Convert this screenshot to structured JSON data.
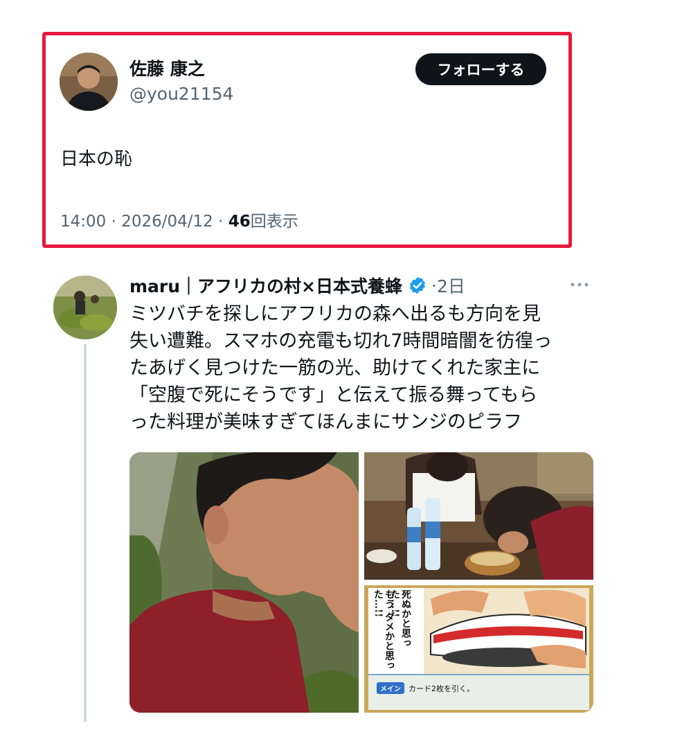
{
  "main_tweet": {
    "display_name": "佐藤 康之",
    "handle": "@you21154",
    "follow_label": "フォローする",
    "text": "日本の恥",
    "time": "14:00",
    "date": "2026/04/12",
    "views_count": "46",
    "views_label": "回表示",
    "separator": "·"
  },
  "reply": {
    "display_name": "maru｜アフリカの村×日本式養蜂",
    "time_separator": "·",
    "time": "2日",
    "lines": [
      "ミツバチを探しにアフリカの森へ出るも方向を見",
      "失い遭難。スマホの充電も切れ7時間暗闇を彷徨っ",
      "たあげく見つけた一筋の光、助けてくれた家主に",
      "「空腹で死にそうです」と伝えて振る舞ってもら",
      "った料理が美味すぎてほんまにサンジのピラフ"
    ],
    "manga": {
      "bubble_1": "死ぬかと思った…!!",
      "bubble_2": "もう ダメかと思った…!!",
      "tag": "メイン",
      "caption": "カード2枚を引く。"
    }
  },
  "colors": {
    "highlight_border": "#e8193c",
    "verified_blue": "#1d9bf0",
    "secondary_text": "#536471",
    "follow_bg": "#0f1419"
  },
  "icons": [
    "verified-badge-icon",
    "more-options-icon"
  ]
}
